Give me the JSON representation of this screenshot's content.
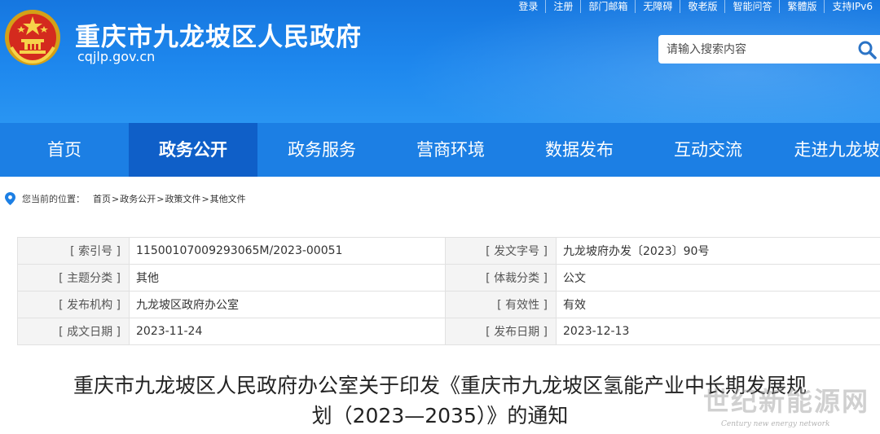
{
  "header": {
    "title": "重庆市九龙坡区人民政府",
    "domain": "cqjlp.gov.cn",
    "emblem_icon": "national-emblem-icon",
    "top_links": [
      "登录",
      "注册",
      "部门邮箱",
      "无障碍",
      "敬老版",
      "智能问答",
      "繁體版",
      "支持IPv6"
    ],
    "search": {
      "placeholder": "请输入搜索内容",
      "icon": "search-icon"
    }
  },
  "nav": {
    "items": [
      {
        "label": "首页"
      },
      {
        "label": "政务公开"
      },
      {
        "label": "政务服务"
      },
      {
        "label": "营商环境"
      },
      {
        "label": "数据发布"
      },
      {
        "label": "互动交流"
      },
      {
        "label": "走进九龙坡"
      }
    ],
    "active_index": 1
  },
  "breadcrumb": {
    "icon": "location-pin-icon",
    "label": "您当前的位置：",
    "items": [
      "首页",
      "政务公开",
      "政策文件",
      "其他文件"
    ],
    "separator": ">"
  },
  "meta_table": {
    "rows": [
      {
        "k1": "[ 索引号 ]",
        "v1": "11500107009293065M/2023-00051",
        "k2": "[ 发文字号 ]",
        "v2": "九龙坡府办发〔2023〕90号"
      },
      {
        "k1": "[ 主题分类 ]",
        "v1": "其他",
        "k2": "[ 体裁分类 ]",
        "v2": "公文"
      },
      {
        "k1": "[ 发布机构 ]",
        "v1": "九龙坡区政府办公室",
        "k2": "[ 有效性 ]",
        "v2": "有效"
      },
      {
        "k1": "[ 成文日期 ]",
        "v1": "2023-11-24",
        "k2": "[ 发布日期 ]",
        "v2": "2023-12-13"
      }
    ]
  },
  "document": {
    "title_line1": "重庆市九龙坡区人民政府办公室关于印发《重庆市九龙坡区氢能产业中长期发展规",
    "title_line2": "划（2023—2035）》的通知"
  },
  "watermark": {
    "text": "世纪新能源网",
    "subtext": "Century new energy network"
  },
  "colors": {
    "header_blue": "#1e88ee",
    "nav_blue": "#1c7fe4",
    "nav_active": "#0f5fc8",
    "search_icon": "#1565c0",
    "pin_icon": "#1c7fe4"
  }
}
